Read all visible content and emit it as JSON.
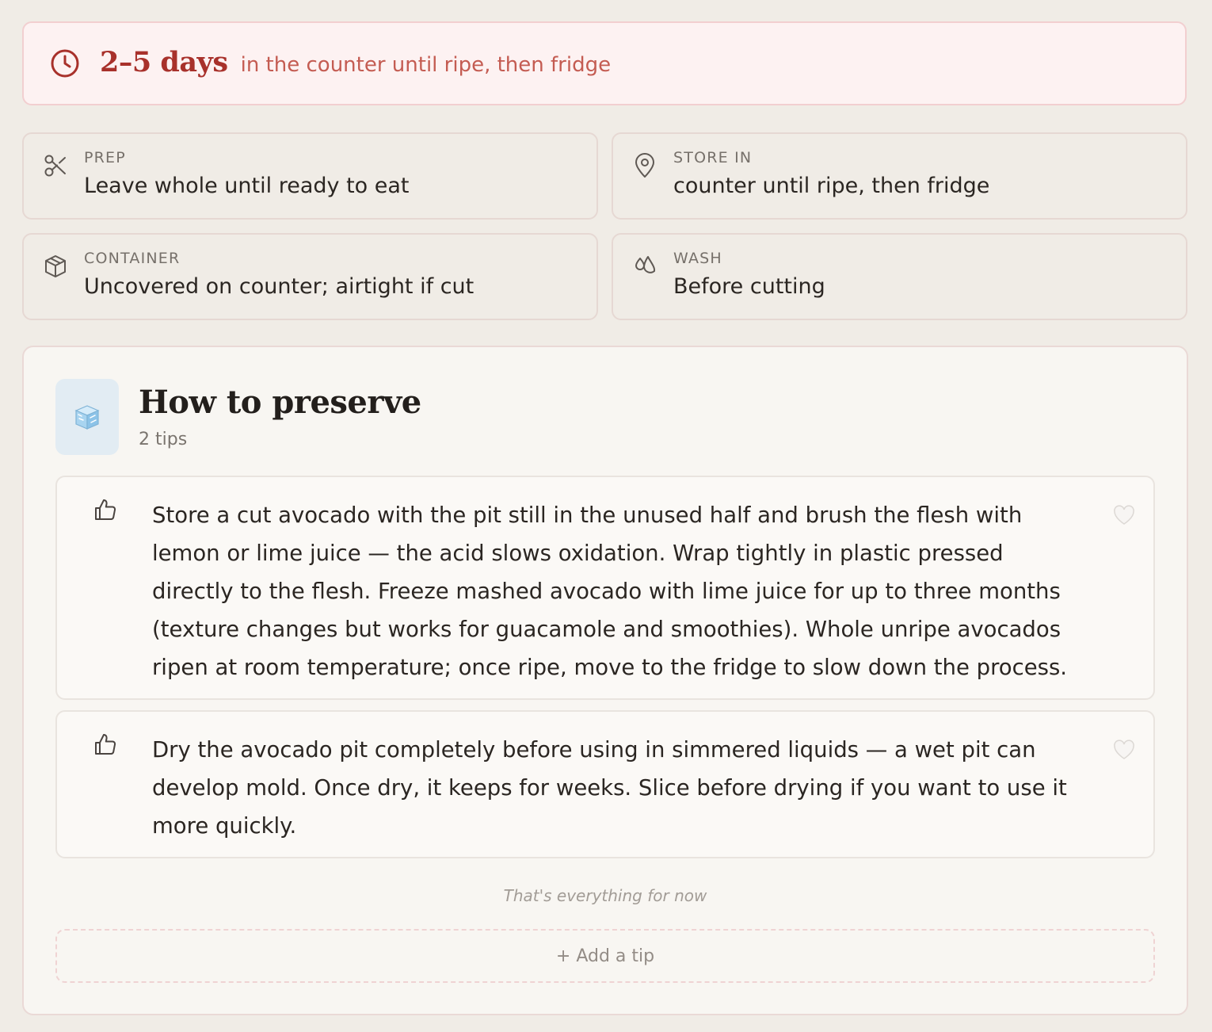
{
  "shelf_life": {
    "duration": "2–5 days",
    "note": "in the counter until ripe, then fridge",
    "icon": "clock-icon",
    "accent_color": "#a8312b"
  },
  "info_cards": {
    "prep": {
      "label": "PREP",
      "value": "Leave whole until ready to eat",
      "icon": "scissors-icon"
    },
    "store": {
      "label": "STORE IN",
      "value": "counter until ripe, then fridge",
      "icon": "location-pin-icon"
    },
    "container": {
      "label": "CONTAINER",
      "value": "Uncovered on counter; airtight if cut",
      "icon": "box-icon"
    },
    "wash": {
      "label": "WASH",
      "value": "Before cutting",
      "icon": "droplets-icon"
    }
  },
  "preserve": {
    "icon": "ice-cube-icon",
    "title": "How to preserve",
    "count": "2 tips",
    "tips": [
      {
        "text": "Store a cut avocado with the pit still in the unused half and brush the flesh with lemon or lime juice — the acid slows oxidation. Wrap tightly in plastic pressed directly to the flesh. Freeze mashed avocado with lime juice for up to three months (texture changes but works for guacamole and smoothies). Whole unripe avocados ripen at room temperature; once ripe, move to the fridge to slow down the process."
      },
      {
        "text": "Dry the avocado pit completely before using in simmered liquids — a wet pit can develop mold. Once dry, it keeps for weeks. Slice before drying if you want to use it more quickly."
      }
    ],
    "end_note": "That's everything for now",
    "add_tip_label": "+ Add a tip"
  }
}
